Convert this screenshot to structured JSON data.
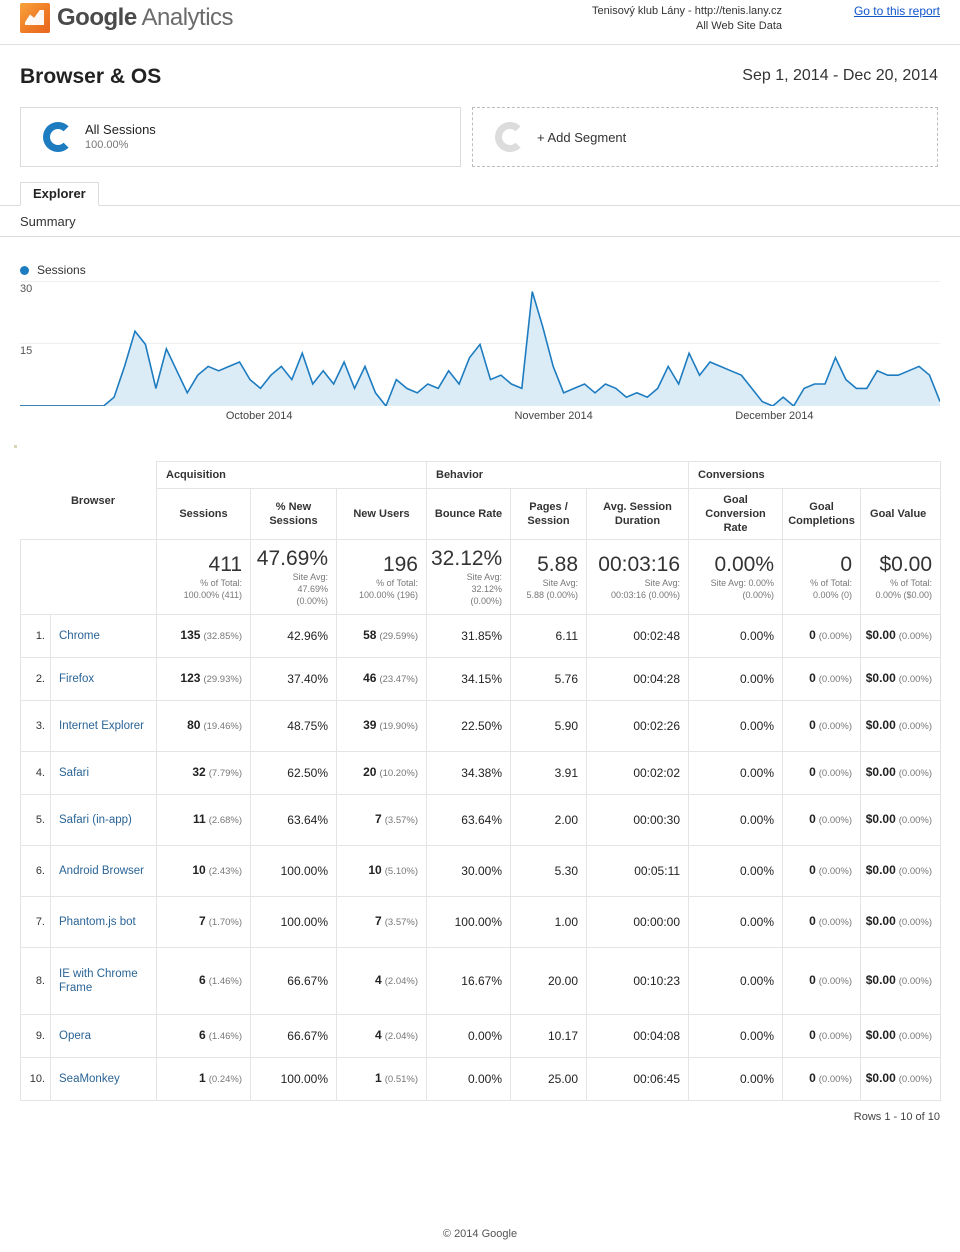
{
  "header": {
    "logo_word_bold": "Google",
    "logo_word_light": " Analytics",
    "account_line1": "Tenisový klub Lány - http://tenis.lany.cz",
    "account_line2": "All Web Site Data",
    "goto_report": "Go to this report"
  },
  "report": {
    "title": "Browser & OS",
    "date_range": "Sep 1, 2014 - Dec 20, 2014"
  },
  "segments": {
    "all_sessions_label": "All Sessions",
    "all_sessions_pct": "100.00%",
    "add_segment_label": "+ Add Segment"
  },
  "tabs": {
    "explorer": "Explorer",
    "summary": "Summary"
  },
  "chart_data": {
    "type": "area",
    "title": "Sessions",
    "xlabel": "",
    "ylabel": "Sessions",
    "ylim": [
      0,
      30
    ],
    "yticks": [
      "30",
      "15"
    ],
    "grid": true,
    "legend": [
      "Sessions"
    ],
    "legend_position": "top-left",
    "month_labels": [
      "October 2014",
      "November 2014",
      "December 2014"
    ],
    "series_name": "Sessions",
    "line_color": "#1d7cc0",
    "fill_color": "#dcecf7",
    "values": [
      0,
      0,
      0,
      0,
      0,
      0,
      0,
      0,
      0,
      2,
      9,
      17,
      14,
      4,
      13,
      8,
      3,
      7,
      9,
      8,
      9,
      10,
      6,
      4,
      7,
      9,
      6,
      12,
      5,
      8,
      5,
      10,
      4,
      9,
      3,
      0,
      6,
      4,
      3,
      5,
      4,
      8,
      5,
      11,
      14,
      6,
      7,
      5,
      4,
      26,
      18,
      9,
      3,
      4,
      5,
      3,
      5,
      4,
      2,
      3,
      2,
      4,
      9,
      5,
      12,
      7,
      10,
      9,
      8,
      7,
      4,
      1,
      0,
      2,
      0,
      4,
      5,
      5,
      11,
      6,
      4,
      4,
      8,
      7,
      7,
      8,
      9,
      7,
      1
    ]
  },
  "table": {
    "dimension_header": "Browser",
    "groups": [
      {
        "label": "Acquisition",
        "span": 3
      },
      {
        "label": "Behavior",
        "span": 3
      },
      {
        "label": "Conversions",
        "span": 3
      }
    ],
    "columns": [
      "Sessions",
      "% New Sessions",
      "New Users",
      "Bounce Rate",
      "Pages / Session",
      "Avg. Session Duration",
      "Goal Conversion Rate",
      "Goal Completions",
      "Goal Value"
    ],
    "summary": [
      {
        "big": "411",
        "sub": [
          "% of Total:",
          "100.00% (411)"
        ]
      },
      {
        "big": "47.69%",
        "sub": [
          "Site Avg:",
          "47.69%",
          "(0.00%)"
        ]
      },
      {
        "big": "196",
        "sub": [
          "% of Total:",
          "100.00% (196)"
        ]
      },
      {
        "big": "32.12%",
        "sub": [
          "Site Avg:",
          "32.12%",
          "(0.00%)"
        ]
      },
      {
        "big": "5.88",
        "sub": [
          "Site Avg:",
          "5.88 (0.00%)"
        ]
      },
      {
        "big": "00:03:16",
        "sub": [
          "Site Avg:",
          "00:03:16 (0.00%)"
        ]
      },
      {
        "big": "0.00%",
        "sub": [
          "Site Avg: 0.00%",
          "(0.00%)"
        ]
      },
      {
        "big": "0",
        "sub": [
          "% of Total:",
          "0.00% (0)"
        ]
      },
      {
        "big": "$0.00",
        "sub": [
          "% of Total:",
          "0.00% ($0.00)"
        ]
      }
    ],
    "rows": [
      {
        "idx": "1.",
        "name": "Chrome",
        "sessions": "135",
        "sessions_pct": "(32.85%)",
        "new_sessions": "42.96%",
        "new_users": "58",
        "new_users_pct": "(29.59%)",
        "bounce": "31.85%",
        "pages": "6.11",
        "duration": "00:02:48",
        "goal_rate": "0.00%",
        "completions": "0",
        "completions_pct": "(0.00%)",
        "value": "$0.00",
        "value_pct": "(0.00%)"
      },
      {
        "idx": "2.",
        "name": "Firefox",
        "sessions": "123",
        "sessions_pct": "(29.93%)",
        "new_sessions": "37.40%",
        "new_users": "46",
        "new_users_pct": "(23.47%)",
        "bounce": "34.15%",
        "pages": "5.76",
        "duration": "00:04:28",
        "goal_rate": "0.00%",
        "completions": "0",
        "completions_pct": "(0.00%)",
        "value": "$0.00",
        "value_pct": "(0.00%)"
      },
      {
        "idx": "3.",
        "name": "Internet Explorer",
        "sessions": "80",
        "sessions_pct": "(19.46%)",
        "new_sessions": "48.75%",
        "new_users": "39",
        "new_users_pct": "(19.90%)",
        "bounce": "22.50%",
        "pages": "5.90",
        "duration": "00:02:26",
        "goal_rate": "0.00%",
        "completions": "0",
        "completions_pct": "(0.00%)",
        "value": "$0.00",
        "value_pct": "(0.00%)"
      },
      {
        "idx": "4.",
        "name": "Safari",
        "sessions": "32",
        "sessions_pct": "(7.79%)",
        "new_sessions": "62.50%",
        "new_users": "20",
        "new_users_pct": "(10.20%)",
        "bounce": "34.38%",
        "pages": "3.91",
        "duration": "00:02:02",
        "goal_rate": "0.00%",
        "completions": "0",
        "completions_pct": "(0.00%)",
        "value": "$0.00",
        "value_pct": "(0.00%)"
      },
      {
        "idx": "5.",
        "name": "Safari (in-app)",
        "sessions": "11",
        "sessions_pct": "(2.68%)",
        "new_sessions": "63.64%",
        "new_users": "7",
        "new_users_pct": "(3.57%)",
        "bounce": "63.64%",
        "pages": "2.00",
        "duration": "00:00:30",
        "goal_rate": "0.00%",
        "completions": "0",
        "completions_pct": "(0.00%)",
        "value": "$0.00",
        "value_pct": "(0.00%)"
      },
      {
        "idx": "6.",
        "name": "Android Browser",
        "sessions": "10",
        "sessions_pct": "(2.43%)",
        "new_sessions": "100.00%",
        "new_users": "10",
        "new_users_pct": "(5.10%)",
        "bounce": "30.00%",
        "pages": "5.30",
        "duration": "00:05:11",
        "goal_rate": "0.00%",
        "completions": "0",
        "completions_pct": "(0.00%)",
        "value": "$0.00",
        "value_pct": "(0.00%)"
      },
      {
        "idx": "7.",
        "name": "Phantom.js bot",
        "sessions": "7",
        "sessions_pct": "(1.70%)",
        "new_sessions": "100.00%",
        "new_users": "7",
        "new_users_pct": "(3.57%)",
        "bounce": "100.00%",
        "pages": "1.00",
        "duration": "00:00:00",
        "goal_rate": "0.00%",
        "completions": "0",
        "completions_pct": "(0.00%)",
        "value": "$0.00",
        "value_pct": "(0.00%)"
      },
      {
        "idx": "8.",
        "name": "IE with Chrome Frame",
        "sessions": "6",
        "sessions_pct": "(1.46%)",
        "new_sessions": "66.67%",
        "new_users": "4",
        "new_users_pct": "(2.04%)",
        "bounce": "16.67%",
        "pages": "20.00",
        "duration": "00:10:23",
        "goal_rate": "0.00%",
        "completions": "0",
        "completions_pct": "(0.00%)",
        "value": "$0.00",
        "value_pct": "(0.00%)"
      },
      {
        "idx": "9.",
        "name": "Opera",
        "sessions": "6",
        "sessions_pct": "(1.46%)",
        "new_sessions": "66.67%",
        "new_users": "4",
        "new_users_pct": "(2.04%)",
        "bounce": "0.00%",
        "pages": "10.17",
        "duration": "00:04:08",
        "goal_rate": "0.00%",
        "completions": "0",
        "completions_pct": "(0.00%)",
        "value": "$0.00",
        "value_pct": "(0.00%)"
      },
      {
        "idx": "10.",
        "name": "SeaMonkey",
        "sessions": "1",
        "sessions_pct": "(0.24%)",
        "new_sessions": "100.00%",
        "new_users": "1",
        "new_users_pct": "(0.51%)",
        "bounce": "0.00%",
        "pages": "25.00",
        "duration": "00:06:45",
        "goal_rate": "0.00%",
        "completions": "0",
        "completions_pct": "(0.00%)",
        "value": "$0.00",
        "value_pct": "(0.00%)"
      }
    ],
    "rows_footer": "Rows 1 - 10 of 10"
  },
  "footer": {
    "copyright": "© 2014 Google"
  }
}
